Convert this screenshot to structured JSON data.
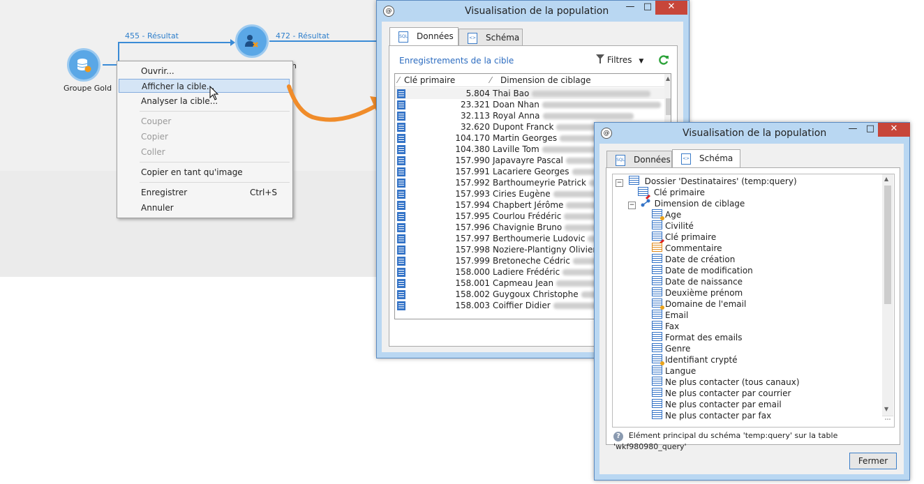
{
  "workflow": {
    "node1_label": "Groupe Gold",
    "link1_label": "455 - Résultat",
    "link2_label": "472 - Résultat",
    "node2_label_fragment": "n"
  },
  "context_menu": {
    "open": "Ouvrir...",
    "show_target": "Afficher la cible...",
    "analyze_target": "Analyser la cible...",
    "cut": "Couper",
    "copy": "Copier",
    "paste": "Coller",
    "copy_as_image": "Copier en tant qu'image",
    "save": "Enregistrer",
    "save_shortcut": "Ctrl+S",
    "cancel": "Annuler"
  },
  "window1": {
    "title": "Visualisation de la population",
    "tabs": [
      "Données",
      "Schéma"
    ],
    "records_label": "Enregistrements de la cible",
    "filters_label": "Filtres",
    "columns": [
      "Clé primaire",
      "Dimension de ciblage"
    ],
    "rows": [
      {
        "key": "5.804",
        "name": "Thai Bao"
      },
      {
        "key": "23.321",
        "name": "Doan Nhan"
      },
      {
        "key": "32.113",
        "name": "Royal Anna"
      },
      {
        "key": "32.620",
        "name": "Dupont Franck"
      },
      {
        "key": "104.170",
        "name": "Martin Georges"
      },
      {
        "key": "104.380",
        "name": "Laville Tom"
      },
      {
        "key": "157.990",
        "name": "Japavayre Pascal"
      },
      {
        "key": "157.991",
        "name": "Lacariere Georges"
      },
      {
        "key": "157.992",
        "name": "Barthoumeyrie Patrick"
      },
      {
        "key": "157.993",
        "name": "Ciries Eugène"
      },
      {
        "key": "157.994",
        "name": "Chapbert Jérôme"
      },
      {
        "key": "157.995",
        "name": "Courlou Frédéric"
      },
      {
        "key": "157.996",
        "name": "Chavignie Bruno"
      },
      {
        "key": "157.997",
        "name": "Berthoumerie Ludovic"
      },
      {
        "key": "157.998",
        "name": "Noziere-Plantigny Olivier"
      },
      {
        "key": "157.999",
        "name": "Bretoneche Cédric"
      },
      {
        "key": "158.000",
        "name": "Ladiere Frédéric"
      },
      {
        "key": "158.001",
        "name": "Capmeau Jean"
      },
      {
        "key": "158.002",
        "name": "Guygoux Christophe"
      },
      {
        "key": "158.003",
        "name": "Coiffier Didier"
      }
    ]
  },
  "window2": {
    "title": "Visualisation de la population",
    "tabs": [
      "Données",
      "Schéma"
    ],
    "root": "Dossier 'Destinataires' (temp:query)",
    "primary_key": "Clé primaire",
    "dimension": "Dimension de ciblage",
    "fields": [
      {
        "label": "Age",
        "icon": "gear"
      },
      {
        "label": "Civilité",
        "icon": "plain"
      },
      {
        "label": "Clé primaire",
        "icon": "key"
      },
      {
        "label": "Commentaire",
        "icon": "orange"
      },
      {
        "label": "Date de création",
        "icon": "plain"
      },
      {
        "label": "Date de modification",
        "icon": "plain"
      },
      {
        "label": "Date de naissance",
        "icon": "plain"
      },
      {
        "label": "Deuxième prénom",
        "icon": "plain"
      },
      {
        "label": "Domaine de l'email",
        "icon": "gear"
      },
      {
        "label": "Email",
        "icon": "plain"
      },
      {
        "label": "Fax",
        "icon": "plain"
      },
      {
        "label": "Format des emails",
        "icon": "plain"
      },
      {
        "label": "Genre",
        "icon": "plain"
      },
      {
        "label": "Identifiant crypté",
        "icon": "gear"
      },
      {
        "label": "Langue",
        "icon": "plain"
      },
      {
        "label": "Ne plus contacter (tous canaux)",
        "icon": "plain"
      },
      {
        "label": "Ne plus contacter par courrier",
        "icon": "plain"
      },
      {
        "label": "Ne plus contacter par email",
        "icon": "plain"
      },
      {
        "label": "Ne plus contacter par fax",
        "icon": "plain"
      }
    ],
    "status": "Elément principal du schéma 'temp:query' sur la table 'wkf980980_query'",
    "close_button": "Fermer"
  }
}
